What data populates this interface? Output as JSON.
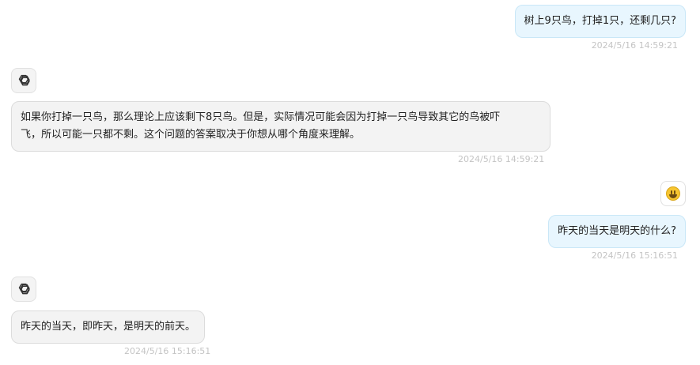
{
  "messages": [
    {
      "role": "user",
      "text": "树上9只鸟，打掉1只，还剩几只?",
      "time": "2024/5/16 14:59:21"
    },
    {
      "role": "assistant",
      "avatar_icon": "openai-logo-icon",
      "text_line1": "如果你打掉一只鸟，那么理论上应该剩下8只鸟。但是，实际情况可能会因为打掉一只鸟导致其它的鸟被吓",
      "text_line2": "飞，所以可能一只都不剩。这个问题的答案取决于你想从哪个角度来理解。",
      "time": "2024/5/16 14:59:21"
    },
    {
      "role": "user",
      "avatar_icon": "smiley-emoji-icon",
      "text": "昨天的当天是明天的什么?",
      "time": "2024/5/16 15:16:51"
    },
    {
      "role": "assistant",
      "avatar_icon": "openai-logo-icon",
      "text": "昨天的当天，即昨天，是明天的前天。",
      "time": "2024/5/16 15:16:51"
    }
  ],
  "colors": {
    "user_bubble": "#e8f6fe",
    "bot_bubble": "#f3f3f3",
    "timestamp": "#c4c4c4"
  }
}
